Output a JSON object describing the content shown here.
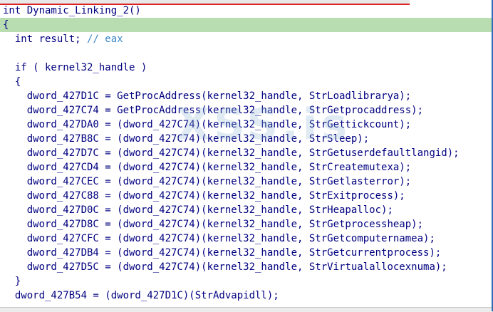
{
  "watermark": "XSS.is",
  "lines": [
    "int Dynamic_Linking_2()",
    "{",
    "  int result; // eax",
    "",
    "  if ( kernel32_handle )",
    "  {",
    "    dword_427D1C = GetProcAddress(kernel32_handle, StrLoadlibrarya);",
    "    dword_427C74 = GetProcAddress(kernel32_handle, StrGetprocaddress);",
    "    dword_427DA0 = (dword_427C74)(kernel32_handle, StrGettickcount);",
    "    dword_427B8C = (dword_427C74)(kernel32_handle, StrSleep);",
    "    dword_427D7C = (dword_427C74)(kernel32_handle, StrGetuserdefaultlangid);",
    "    dword_427CD4 = (dword_427C74)(kernel32_handle, StrCreatemutexa);",
    "    dword_427CEC = (dword_427C74)(kernel32_handle, StrGetlasterror);",
    "    dword_427C88 = (dword_427C74)(kernel32_handle, StrExitprocess);",
    "    dword_427D0C = (dword_427C74)(kernel32_handle, StrHeapalloc);",
    "    dword_427D8C = (dword_427C74)(kernel32_handle, StrGetprocessheap);",
    "    dword_427CFC = (dword_427C74)(kernel32_handle, StrGetcomputernamea);",
    "    dword_427DB4 = (dword_427C74)(kernel32_handle, StrGetcurrentprocess);",
    "    dword_427D5C = (dword_427C74)(kernel32_handle, StrVirtualallocexnuma);",
    "  }",
    "  dword_427B54 = (dword_427D1C)(StrAdvapidll);"
  ],
  "colors": {
    "code": "#000080",
    "comment": "#3a88c8",
    "highlight": "#b8ddb0",
    "border": "#2a6fb5"
  }
}
